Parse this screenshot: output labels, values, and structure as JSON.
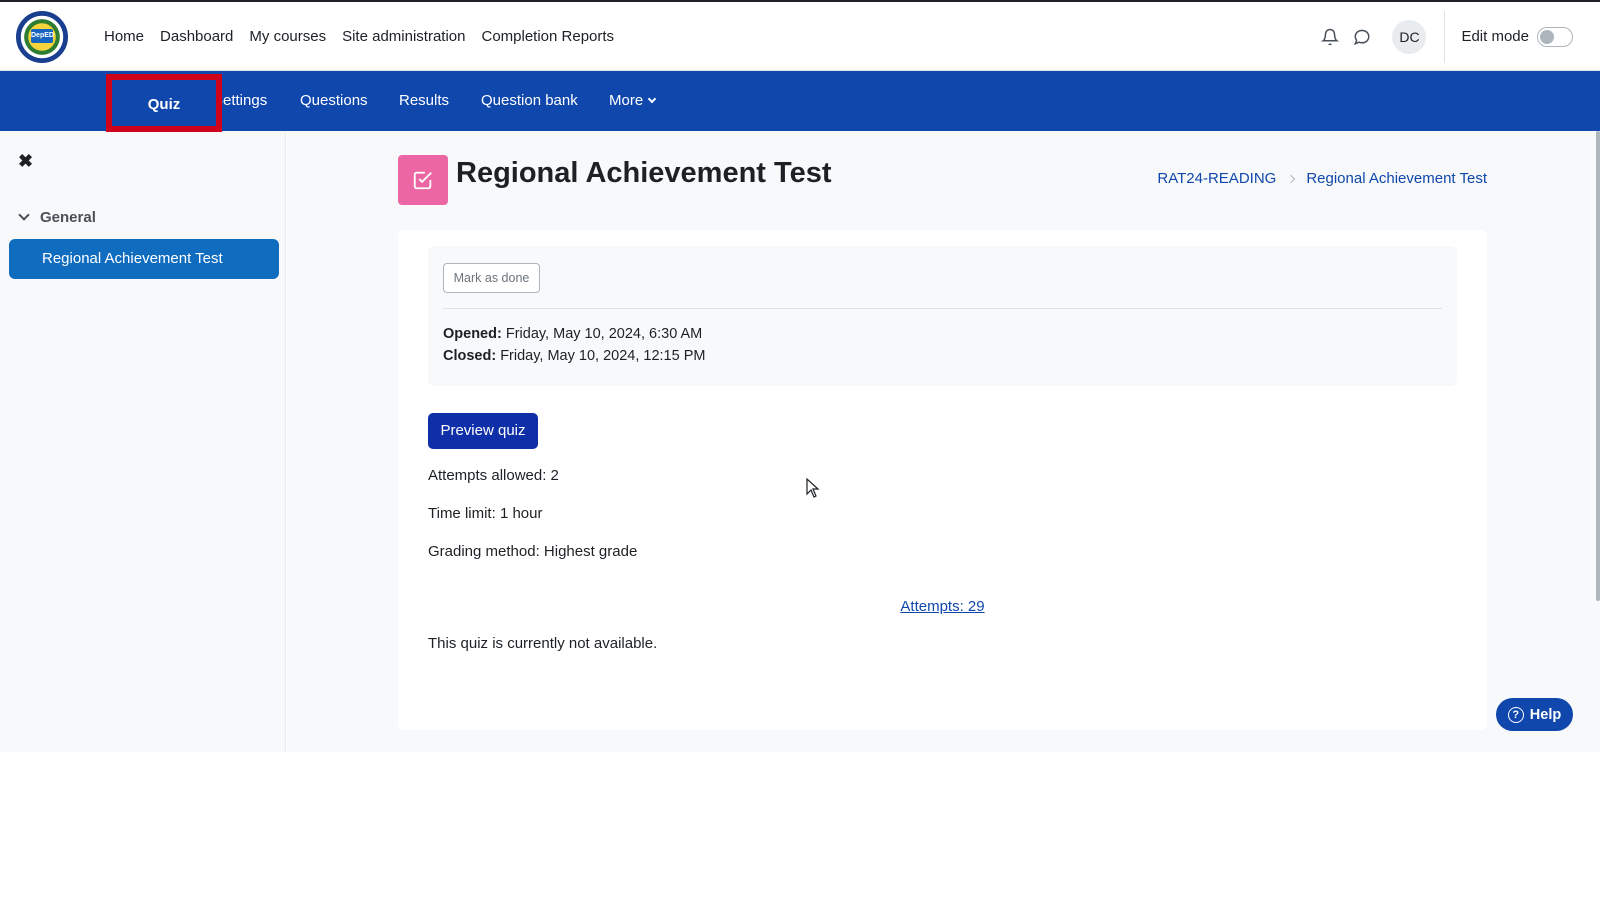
{
  "topnav": {
    "items": [
      "Home",
      "Dashboard",
      "My courses",
      "Site administration",
      "Completion Reports"
    ],
    "avatar_initials": "DC",
    "edit_mode_label": "Edit mode",
    "edit_mode_on": false,
    "logo_text": "DepED"
  },
  "secondary_nav": {
    "tabs": [
      "Quiz",
      "Settings",
      "Questions",
      "Results",
      "Question bank",
      "More"
    ],
    "active": "Quiz",
    "highlight_color": "#d0021b"
  },
  "drawer": {
    "close_symbol": "✖",
    "section": "General",
    "items": [
      "Regional Achievement Test"
    ]
  },
  "page": {
    "title": "Regional Achievement Test",
    "breadcrumb": [
      "RAT24-READING",
      "Regional Achievement Test"
    ]
  },
  "activity": {
    "mark_done_label": "Mark as done",
    "opened_label": "Opened:",
    "opened_value": "Friday, May 10, 2024, 6:30 AM",
    "closed_label": "Closed:",
    "closed_value": "Friday, May 10, 2024, 12:15 PM"
  },
  "quiz": {
    "preview_button": "Preview quiz",
    "attempts_allowed": "Attempts allowed: 2",
    "time_limit": "Time limit: 1 hour",
    "grading_method": "Grading method: Highest grade",
    "attempts_link": "Attempts: 29",
    "status": "This quiz is currently not available."
  },
  "help": {
    "label": "Help",
    "symbol": "?"
  },
  "colors": {
    "brand": "#0f47ad",
    "primary_button": "#0f2fa8",
    "quiz_icon": "#eb66a2",
    "drawer_active": "#0f6cbf"
  }
}
